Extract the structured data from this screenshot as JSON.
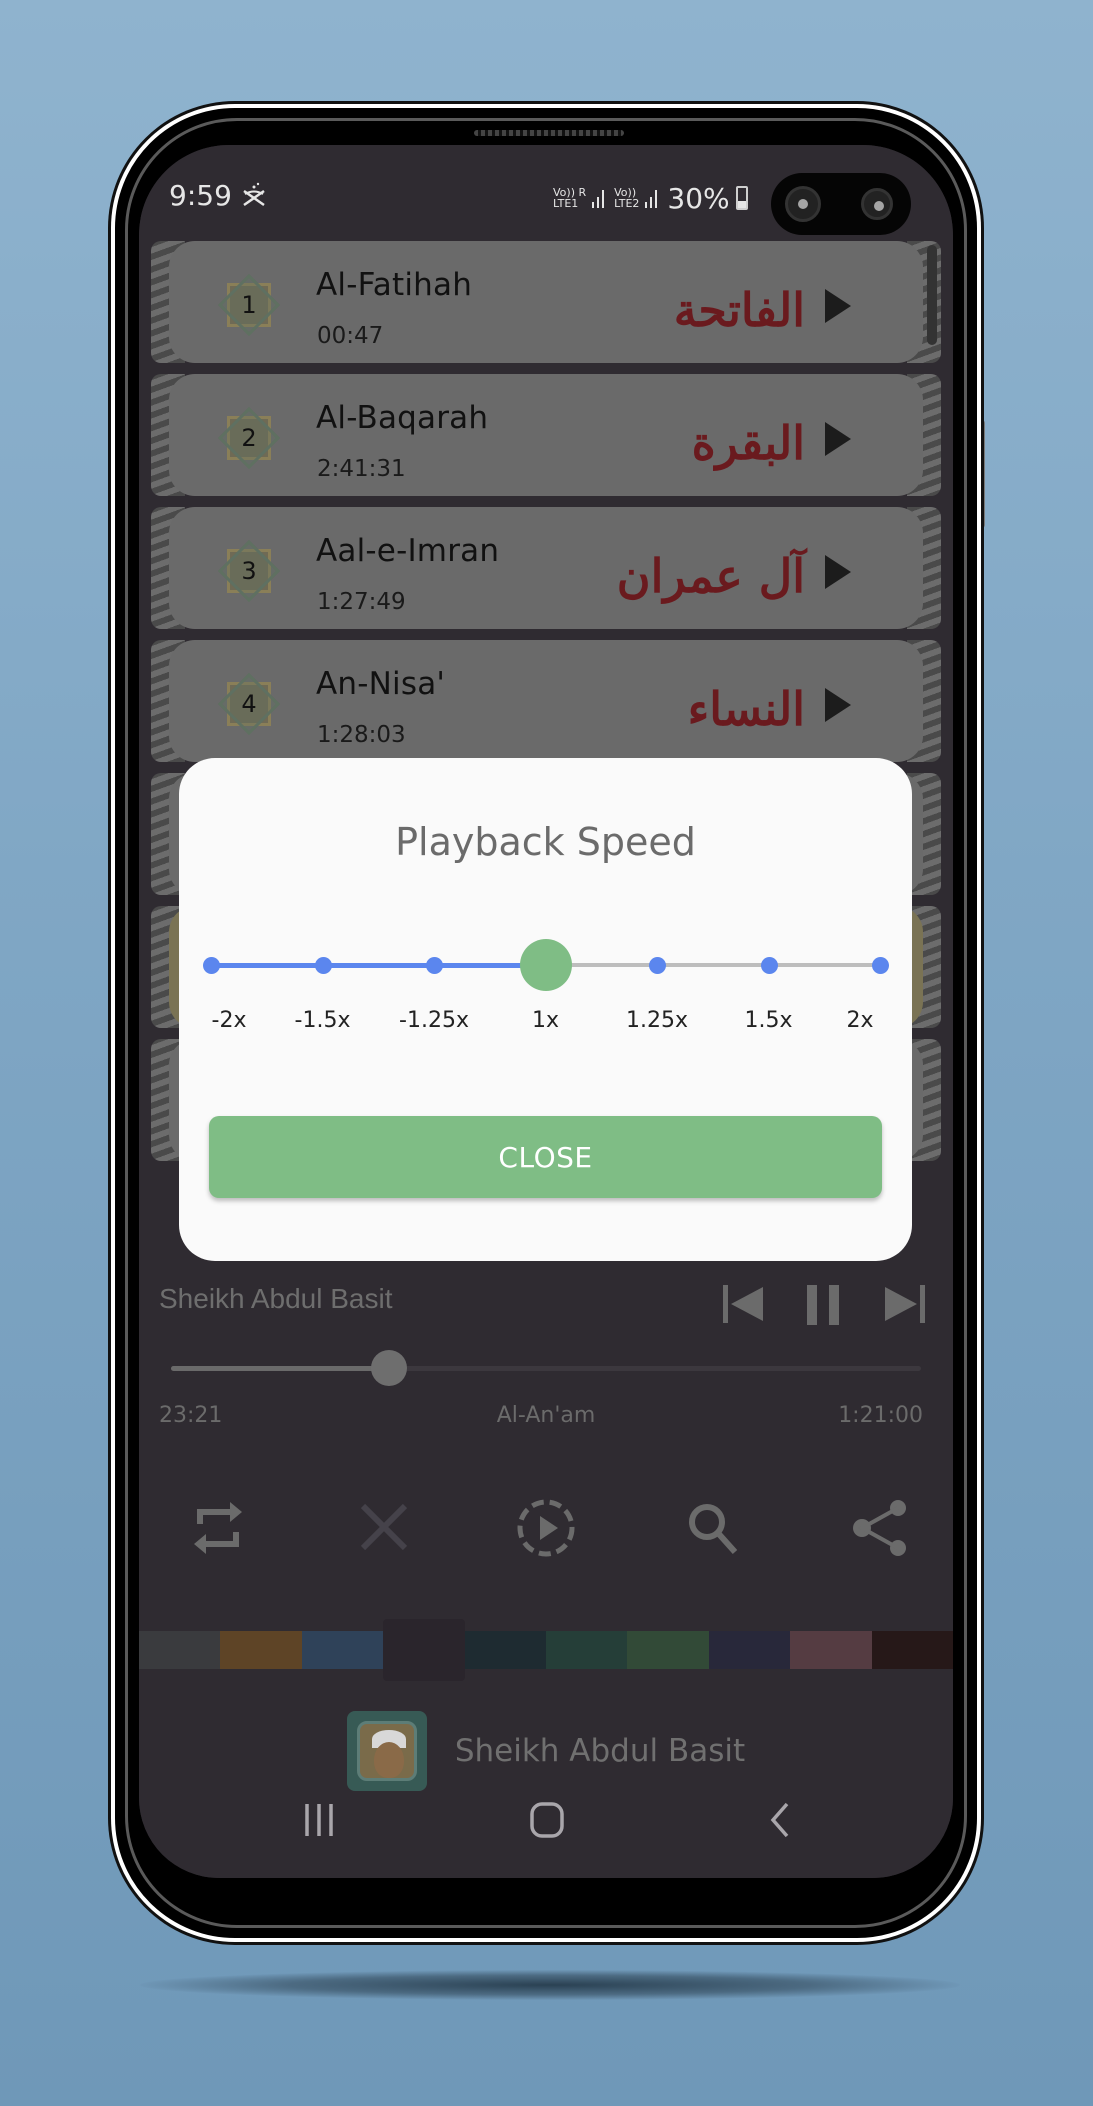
{
  "status_bar": {
    "time": "9:59",
    "notification_icon": "quran-book-icon",
    "sim1_label_top": "Vo)) R",
    "sim1_label_bottom": "LTE1",
    "sim2_label_top": "Vo))",
    "sim2_label_bottom": "LTE2",
    "battery_percent": "30%"
  },
  "surah_list": [
    {
      "number": "1",
      "name_en": "Al-Fatihah",
      "duration": "00:47",
      "name_ar": "الفاتحة",
      "highlighted": false
    },
    {
      "number": "2",
      "name_en": "Al-Baqarah",
      "duration": "2:41:31",
      "name_ar": "البقرة",
      "highlighted": false
    },
    {
      "number": "3",
      "name_en": "Aal-e-Imran",
      "duration": "1:27:49",
      "name_ar": "آل عمران",
      "highlighted": false
    },
    {
      "number": "4",
      "name_en": "An-Nisa'",
      "duration": "1:28:03",
      "name_ar": "النساء",
      "highlighted": false
    },
    {
      "number": "",
      "name_en": "",
      "duration": "",
      "name_ar": "",
      "highlighted": false
    },
    {
      "number": "",
      "name_en": "",
      "duration": "",
      "name_ar": "",
      "highlighted": true
    },
    {
      "number": "",
      "name_en": "",
      "duration": "",
      "name_ar": "",
      "highlighted": false
    }
  ],
  "player": {
    "reciter_small": "Sheikh Abdul Basit",
    "elapsed": "23:21",
    "current_surah": "Al-An'am",
    "total": "1:21:00",
    "progress_fraction": 0.29,
    "controls": [
      "previous-icon",
      "pause-icon",
      "next-icon"
    ],
    "tools": [
      "repeat-icon",
      "shuffle-icon",
      "playback-speed-icon",
      "search-icon",
      "share-icon"
    ],
    "theme_swatches": [
      "#3a3b3e",
      "#5e4426",
      "#2f4259",
      "#2a252c",
      "#1e2b31",
      "#253e38",
      "#324a37",
      "#28283a",
      "#553c42",
      "#261818"
    ],
    "selected_swatch_index": 3,
    "reciter_name": "Sheikh Abdul Basit"
  },
  "dialog": {
    "title": "Playback Speed",
    "speed_options": [
      "-2x",
      "-1.5x",
      "-1.25x",
      "1x",
      "1.25x",
      "1.5x",
      "2x"
    ],
    "selected_index": 3,
    "close_label": "CLOSE",
    "colors": {
      "active": "#5b86ee",
      "inactive": "#bdbdbd",
      "thumb": "#7fbd85",
      "button": "#7fbd85"
    }
  },
  "nav_bar": {
    "recents": "recents-icon",
    "home": "home-icon",
    "back": "back-icon"
  }
}
